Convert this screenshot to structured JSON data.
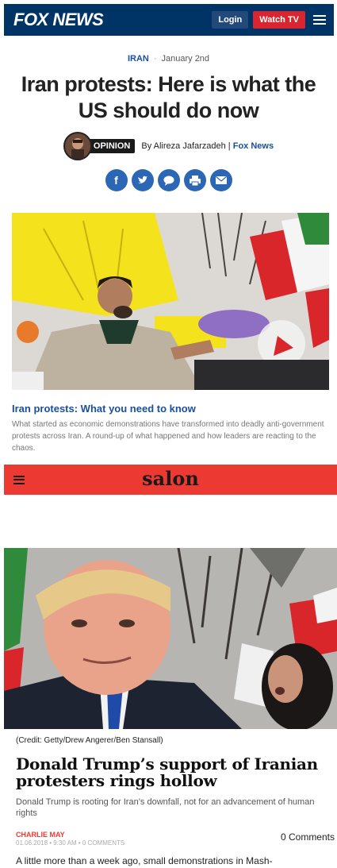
{
  "fox": {
    "logo": "FOX NEWS",
    "login_label": "Login",
    "watch_label": "Watch TV",
    "menu_icon": "hamburger-icon",
    "category": "IRAN",
    "date": "January 2nd",
    "headline": "Iran protests: Here is what the US should do now",
    "opinion_label": "OPINION",
    "byline_prefix": "By Alireza Jafarzadeh |",
    "byline_source": "Fox News",
    "share_icons": [
      "facebook-icon",
      "twitter-icon",
      "comment-icon",
      "print-icon",
      "email-icon"
    ],
    "teaser_title": "Iran protests: What you need to know",
    "teaser_desc": "What started as economic demonstrations have transformed into deadly anti-government protests across Iran. A round-up of what happened and how leaders are reacting to the chaos."
  },
  "salon": {
    "logo": "salon",
    "credit": "(Credit: Getty/Drew Angerer/Ben Stansall)",
    "headline": "Donald Trump’s support of Iranian protesters rings hollow",
    "dek": "Donald Trump is rooting for Iran’s downfall, not for an advancement of human rights",
    "author": "CHARLIE MAY",
    "meta": "01.06.2018 • 9:30 AM • 0 COMMENTS",
    "comments_label": "0 Comments",
    "body_start": "A little more than a week ago, small demonstrations in Mash-"
  },
  "colors": {
    "fox_navy": "#003366",
    "fox_red": "#d8252f",
    "fox_blue": "#2c67b5",
    "salon_red": "#ec3a33"
  }
}
